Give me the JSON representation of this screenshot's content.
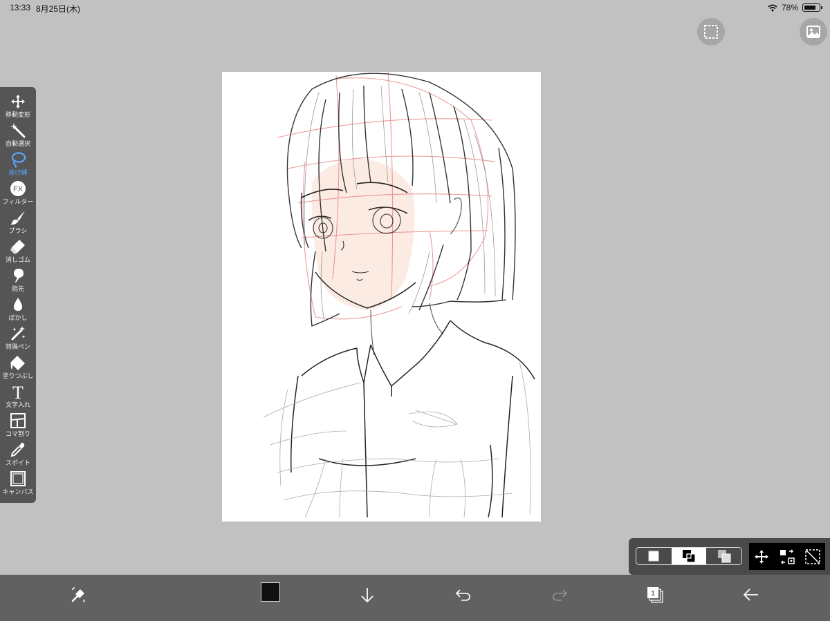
{
  "status": {
    "time": "13:33",
    "date": "8月25日(木)",
    "battery_percent": "78%",
    "battery_level": 0.78
  },
  "top_buttons": [
    {
      "icon": "selection-rect-icon"
    },
    {
      "icon": "gallery-icon"
    }
  ],
  "toolbar": {
    "active_index": 2,
    "accent_color": "#5aa9ff",
    "items": [
      {
        "label": "移動変形",
        "icon": "move-icon"
      },
      {
        "label": "自動選択",
        "icon": "magic-wand-icon"
      },
      {
        "label": "投げ縄",
        "icon": "lasso-icon"
      },
      {
        "label": "フィルター",
        "icon": "fx-icon",
        "text": "FX"
      },
      {
        "label": "ブラシ",
        "icon": "brush-icon"
      },
      {
        "label": "消しゴム",
        "icon": "eraser-icon"
      },
      {
        "label": "指先",
        "icon": "finger-icon"
      },
      {
        "label": "ぼかし",
        "icon": "blur-drop-icon"
      },
      {
        "label": "特殊ペン",
        "icon": "special-pen-icon"
      },
      {
        "label": "塗りつぶし",
        "icon": "bucket-icon"
      },
      {
        "label": "文字入れ",
        "icon": "text-icon",
        "text": "T"
      },
      {
        "label": "コマ割り",
        "icon": "frame-divider-icon"
      },
      {
        "label": "スポイト",
        "icon": "eyedropper-icon"
      },
      {
        "label": "キャンバス",
        "icon": "canvas-icon"
      }
    ]
  },
  "mode_panel": {
    "selected_mode": 1,
    "modes": [
      "new-selection-icon",
      "add-selection-icon",
      "subtract-selection-icon"
    ],
    "actions": [
      "move-selection-icon",
      "transform-selection-icon",
      "deselect-icon"
    ]
  },
  "bottombar": {
    "color": "#111111",
    "layer_count": "1",
    "items": [
      "quick-tools-icon",
      "color-chip",
      "download-icon",
      "undo-icon",
      "redo-icon",
      "layers-icon",
      "back-icon"
    ]
  }
}
